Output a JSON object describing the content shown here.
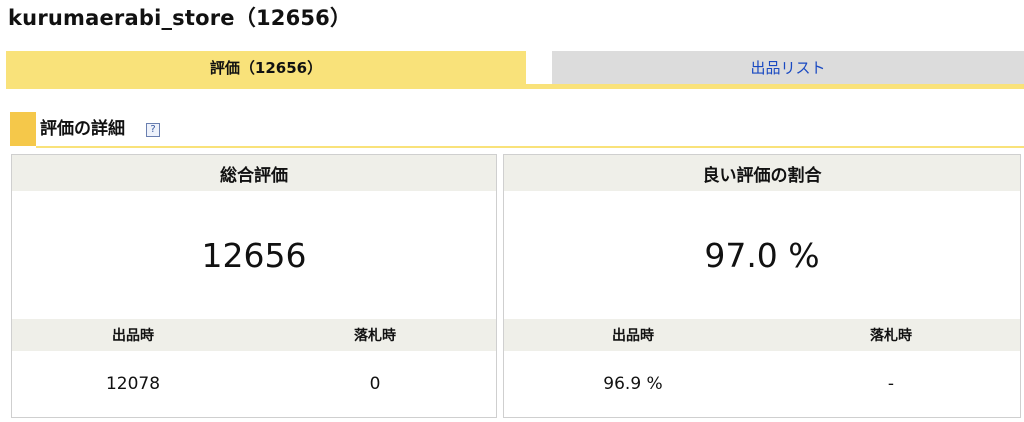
{
  "page": {
    "title": "kurumaerabi_store（12656）"
  },
  "tabs": {
    "active_label": "評価（12656）",
    "inactive_label": "出品リスト"
  },
  "section": {
    "title": "評価の詳細",
    "help_icon": "?"
  },
  "overall": {
    "header": "総合評価",
    "value": "12656",
    "col1_label": "出品時",
    "col2_label": "落札時",
    "col1_value": "12078",
    "col2_value": "0"
  },
  "good_ratio": {
    "header": "良い評価の割合",
    "value": "97.0 %",
    "col1_label": "出品時",
    "col2_label": "落札時",
    "col1_value": "96.9 %",
    "col2_value": "-"
  },
  "colors": {
    "tab_active_bg": "#f9e27a",
    "tab_inactive_bg": "#dcdcdc",
    "link_blue": "#1a4ac2",
    "section_accent": "#f5c84a",
    "panel_header_bg": "#efefe9"
  }
}
